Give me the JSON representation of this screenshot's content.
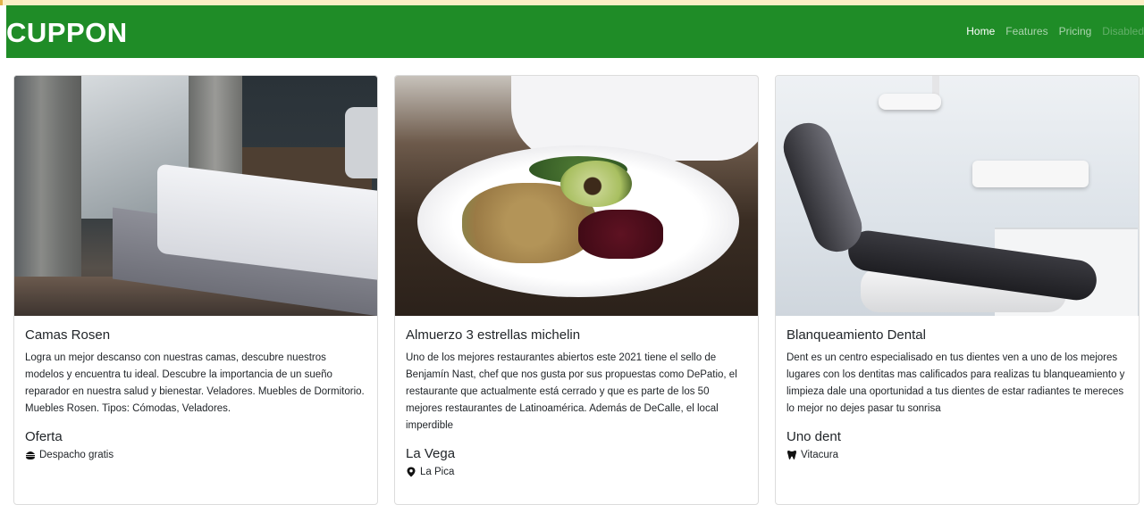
{
  "navbar": {
    "brand": "CUPPON",
    "links": [
      {
        "label": "Home"
      },
      {
        "label": "Features"
      },
      {
        "label": "Pricing"
      },
      {
        "label": "Disabled"
      }
    ]
  },
  "cards": [
    {
      "title": "Camas Rosen",
      "text": "Logra un mejor descanso con nuestras camas, descubre nuestros modelos y encuentra tu ideal. Descubre la importancia de un sueño reparador en nuestra salud y bienestar. Veladores. Muebles de Dormitorio. Muebles Rosen. Tipos: Cómodas, Veladores.",
      "subtitle": "Oferta",
      "tag": "Despacho gratis",
      "tag_icon": "hamburger-icon"
    },
    {
      "title": "Almuerzo 3 estrellas michelin",
      "text": "Uno de los mejores restaurantes abiertos este 2021 tiene el sello de Benjamín Nast, chef que nos gusta por sus propuestas como DePatio, el restaurante que actualmente está cerrado y que es parte de los 50 mejores restaurantes de Latinoamérica. Además de DeCalle, el local imperdible",
      "subtitle": "La Vega",
      "tag": "La Pica",
      "tag_icon": "map-marker-icon"
    },
    {
      "title": "Blanqueamiento Dental",
      "text": "Dent es un centro especialisado en tus dientes ven a uno de los mejores lugares con los dentitas mas calificados para realizas tu blanqueamiento y limpieza dale una oportunidad a tus dientes de estar radiantes te mereces lo mejor no dejes pasar tu sonrisa",
      "subtitle": "Uno dent",
      "tag": "Vitacura",
      "tag_icon": "tooth-icon"
    }
  ],
  "colors": {
    "navbar": "#1f8c27",
    "brand_text": "#ffffff"
  }
}
